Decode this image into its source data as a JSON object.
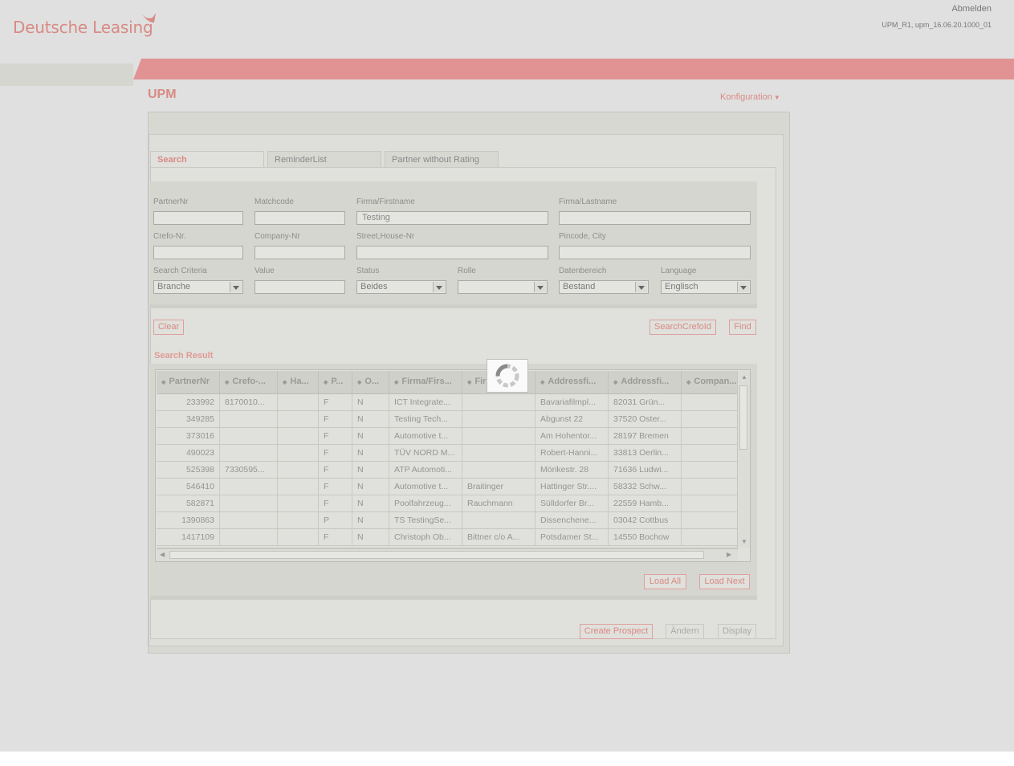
{
  "header": {
    "brand": "Deutsche Leasing",
    "logout": "Abmelden",
    "version": "UPM_R1, upm_16.06.20.1000_01"
  },
  "app": {
    "title": "UPM",
    "config_menu": "Konfiguration"
  },
  "tabs": [
    {
      "label": "Search",
      "active": true
    },
    {
      "label": "ReminderList",
      "active": false
    },
    {
      "label": "Partner without Rating",
      "active": false
    }
  ],
  "form": {
    "partner_nr": {
      "label": "PartnerNr",
      "value": ""
    },
    "matchcode": {
      "label": "Matchcode",
      "value": ""
    },
    "firma_firstname": {
      "label": "Firma/Firstname",
      "value": "Testing"
    },
    "firma_lastname": {
      "label": "Firma/Lastname",
      "value": ""
    },
    "crefo_nr": {
      "label": "Crefo-Nr.",
      "value": ""
    },
    "company_nr": {
      "label": "Company-Nr",
      "value": ""
    },
    "street": {
      "label": "Street,House-Nr",
      "value": ""
    },
    "pincode_city": {
      "label": "Pincode, City",
      "value": ""
    },
    "search_criteria": {
      "label": "Search Criteria",
      "value": "Branche"
    },
    "value": {
      "label": "Value",
      "value": ""
    },
    "status": {
      "label": "Status",
      "value": "Beides"
    },
    "rolle": {
      "label": "Rolle",
      "value": ""
    },
    "datenbereich": {
      "label": "Datenbereich",
      "value": "Bestand"
    },
    "language": {
      "label": "Language",
      "value": "Englisch"
    }
  },
  "buttons": {
    "clear": "Clear",
    "search_crefo": "SearchCrefoId",
    "find": "Find",
    "load_all": "Load All",
    "load_next": "Load Next",
    "create_prospect": "Create Prospect",
    "aendern": "Ändern",
    "display": "Display"
  },
  "results": {
    "title": "Search Result",
    "columns": [
      "PartnerNr",
      "Crefo-...",
      "Ha...",
      "P...",
      "O...",
      "Firma/Firs...",
      "Fir",
      "Addressfi...",
      "Addressfi...",
      "Compan..."
    ],
    "rows": [
      [
        "233992",
        "8170010...",
        "",
        "F",
        "N",
        "ICT Integrate...",
        "",
        "Bavariafilmpl...",
        "82031 Grün...",
        ""
      ],
      [
        "349285",
        "",
        "",
        "F",
        "N",
        "Testing Tech...",
        "",
        "Abgunst 22",
        "37520 Oster...",
        ""
      ],
      [
        "373016",
        "",
        "",
        "F",
        "N",
        "Automotive t...",
        "",
        "Am Hohentor...",
        "28197 Bremen",
        ""
      ],
      [
        "490023",
        "",
        "",
        "F",
        "N",
        "TÜV NORD M...",
        "",
        "Robert-Hanni...",
        "33813 Oerlin...",
        ""
      ],
      [
        "525398",
        "7330595...",
        "",
        "F",
        "N",
        "ATP Automoti...",
        "",
        "Mörikestr. 28",
        "71636 Ludwi...",
        ""
      ],
      [
        "546410",
        "",
        "",
        "F",
        "N",
        "Automotive t...",
        "Braitinger",
        "Hattinger Str....",
        "58332 Schw...",
        ""
      ],
      [
        "582871",
        "",
        "",
        "F",
        "N",
        "Poolfahrzeug...",
        "Rauchmann",
        "Sülldorfer Br...",
        "22559 Hamb...",
        ""
      ],
      [
        "1390863",
        "",
        "",
        "P",
        "N",
        "TS TestingSe...",
        "",
        "Dissenchene...",
        "03042 Cottbus",
        ""
      ],
      [
        "1417109",
        "",
        "",
        "F",
        "N",
        "Christoph Ob...",
        "Bittner c/o A...",
        "Potsdamer St...",
        "14550 Bochow",
        ""
      ]
    ]
  },
  "colors": {
    "brand": "#d98a84",
    "band": "#e19393"
  },
  "icons": {
    "loading": "spinner-icon",
    "sort": "sort-icon",
    "dropdown": "chevron-down-icon"
  }
}
